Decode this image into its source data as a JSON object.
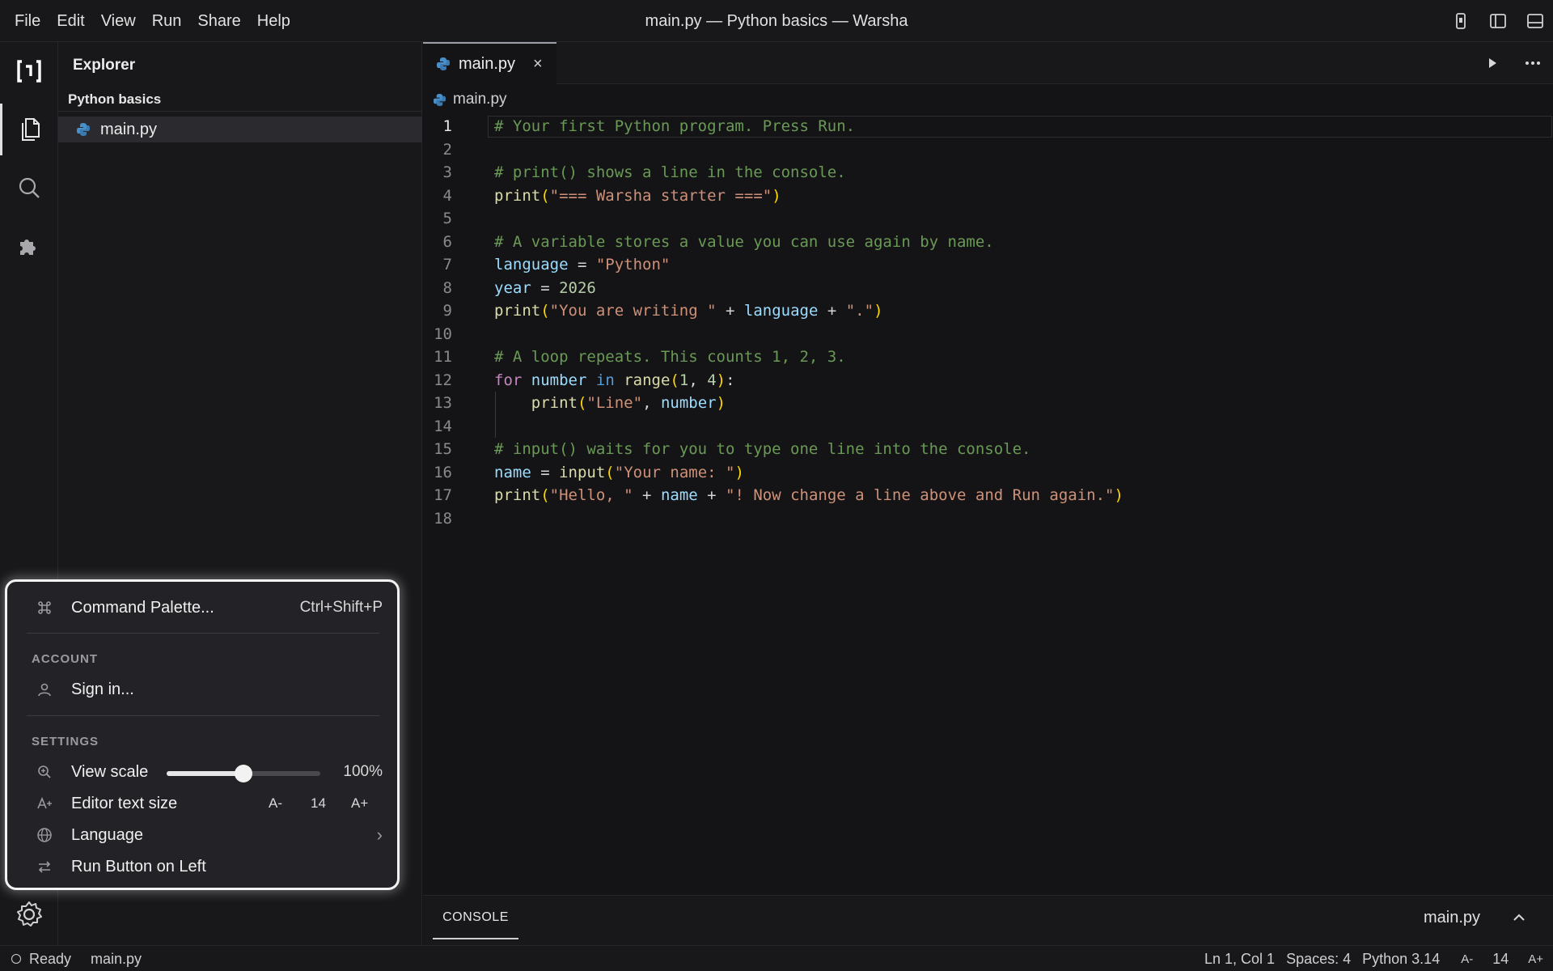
{
  "menu": [
    "File",
    "Edit",
    "View",
    "Run",
    "Share",
    "Help"
  ],
  "window_title": "main.py — Python basics — Warsha",
  "explorer": {
    "title": "Explorer",
    "folder": "Python basics",
    "files": [
      "main.py"
    ]
  },
  "editor": {
    "tab_label": "main.py",
    "tab_close": "×",
    "breadcrumb": "main.py",
    "current_line": 1,
    "lines": [
      [
        [
          "t-com",
          "# Your first Python program. Press Run."
        ]
      ],
      [],
      [
        [
          "t-com",
          "# print() shows a line in the console."
        ]
      ],
      [
        [
          "t-fn",
          "print"
        ],
        [
          "t-p1",
          "("
        ],
        [
          "t-str",
          "\"=== Warsha starter ===\""
        ],
        [
          "t-p1",
          ")"
        ]
      ],
      [],
      [
        [
          "t-com",
          "# A variable stores a value you can use again by name."
        ]
      ],
      [
        [
          "t-var",
          "language"
        ],
        [
          "t-op",
          " = "
        ],
        [
          "t-str",
          "\"Python\""
        ]
      ],
      [
        [
          "t-var",
          "year"
        ],
        [
          "t-op",
          " = "
        ],
        [
          "t-num",
          "2026"
        ]
      ],
      [
        [
          "t-fn",
          "print"
        ],
        [
          "t-p1",
          "("
        ],
        [
          "t-str",
          "\"You are writing \""
        ],
        [
          "t-op",
          " + "
        ],
        [
          "t-var",
          "language"
        ],
        [
          "t-op",
          " + "
        ],
        [
          "t-str",
          "\".\""
        ],
        [
          "t-p1",
          ")"
        ]
      ],
      [],
      [
        [
          "t-com",
          "# A loop repeats. This counts 1, 2, 3."
        ]
      ],
      [
        [
          "t-kw",
          "for"
        ],
        [
          "t-op",
          " "
        ],
        [
          "t-var",
          "number"
        ],
        [
          "t-op",
          " "
        ],
        [
          "t-kb",
          "in"
        ],
        [
          "t-op",
          " "
        ],
        [
          "t-fn",
          "range"
        ],
        [
          "t-p1",
          "("
        ],
        [
          "t-num",
          "1"
        ],
        [
          "t-op",
          ", "
        ],
        [
          "t-num",
          "4"
        ],
        [
          "t-p1",
          ")"
        ],
        [
          "t-op",
          ":"
        ]
      ],
      [
        [
          "t-op",
          "    "
        ],
        [
          "t-fn",
          "print"
        ],
        [
          "t-p1",
          "("
        ],
        [
          "t-str",
          "\"Line\""
        ],
        [
          "t-op",
          ", "
        ],
        [
          "t-var",
          "number"
        ],
        [
          "t-p1",
          ")"
        ]
      ],
      [],
      [
        [
          "t-com",
          "# input() waits for you to type one line into the console."
        ]
      ],
      [
        [
          "t-var",
          "name"
        ],
        [
          "t-op",
          " = "
        ],
        [
          "t-fn",
          "input"
        ],
        [
          "t-p1",
          "("
        ],
        [
          "t-str",
          "\"Your name: \""
        ],
        [
          "t-p1",
          ")"
        ]
      ],
      [
        [
          "t-fn",
          "print"
        ],
        [
          "t-p1",
          "("
        ],
        [
          "t-str",
          "\"Hello, \""
        ],
        [
          "t-op",
          " + "
        ],
        [
          "t-var",
          "name"
        ],
        [
          "t-op",
          " + "
        ],
        [
          "t-str",
          "\"! Now change a line above and Run again.\""
        ],
        [
          "t-p1",
          ")"
        ]
      ],
      []
    ]
  },
  "console": {
    "tab_label": "CONSOLE",
    "file": "main.py"
  },
  "statusbar": {
    "status": "Ready",
    "file": "main.py",
    "position": "Ln 1, Col 1",
    "spaces": "Spaces: 4",
    "language": "Python 3.14",
    "font_down": "A-",
    "font_size": "14",
    "font_up": "A+"
  },
  "popup": {
    "command_palette": "Command Palette...",
    "command_palette_shortcut": "Ctrl+Shift+P",
    "account_header": "ACCOUNT",
    "sign_in": "Sign in...",
    "settings_header": "SETTINGS",
    "view_scale_label": "View scale",
    "view_scale_value": "100%",
    "view_scale_fraction": 0.5,
    "text_size_label": "Editor text size",
    "text_size_down": "A-",
    "text_size_value": "14",
    "text_size_up": "A+",
    "language_label": "Language",
    "language_chevron": "›",
    "run_button_label": "Run Button on Left"
  },
  "colors": {
    "background": "#141417",
    "panel": "#18181b",
    "popup": "#232327",
    "comment": "#6a9955",
    "string": "#ce9178",
    "function": "#dcdcaa",
    "variable": "#9cdcfe",
    "keyword": "#c586c0"
  },
  "icons": [
    "logo-icon",
    "files-icon",
    "search-icon",
    "extensions-icon",
    "gear-icon",
    "python-file-icon",
    "run-icon",
    "more-icon",
    "command-icon",
    "user-icon",
    "zoom-icon",
    "text-size-icon",
    "globe-icon",
    "swap-icon",
    "chevron-up-icon",
    "sidebar-toggle-icon",
    "panel-toggle-icon",
    "device-icon"
  ]
}
